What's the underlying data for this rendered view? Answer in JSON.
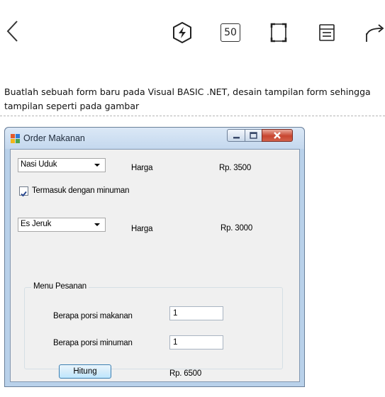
{
  "toolbar": {
    "zoom_value": "50"
  },
  "instruction": {
    "line1": "Buatlah sebuah form baru pada Visual BASIC .NET, desain tampilan form sehingga",
    "line2": "tampilan seperti pada gambar"
  },
  "window": {
    "title": "Order Makanan",
    "food": {
      "selected": "Nasi Uduk",
      "harga_label": "Harga",
      "price": "Rp. 3500"
    },
    "include_drink": {
      "label": "Termasuk dengan minuman",
      "checked": true
    },
    "drink": {
      "selected": "Es Jeruk",
      "harga_label": "Harga",
      "price": "Rp. 3000"
    },
    "group": {
      "title": "Menu Pesanan",
      "food_portion_label": "Berapa porsi makanan",
      "food_portion_value": "1",
      "drink_portion_label": "Berapa porsi minuman",
      "drink_portion_value": "1",
      "button_label": "Hitung",
      "total": "Rp. 6500"
    }
  }
}
